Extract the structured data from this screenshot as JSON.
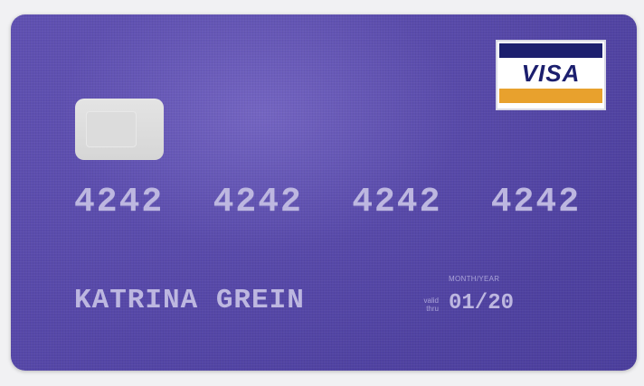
{
  "card": {
    "brand": "VISA",
    "number_groups": [
      "4242",
      "4242",
      "4242",
      "4242"
    ],
    "holder_name": "KATRINA GREIN",
    "expiry_caption": "MONTH/YEAR",
    "valid_thru_line1": "valid",
    "valid_thru_line2": "thru",
    "expiry": "01/20"
  },
  "colors": {
    "card_background": "#5446a6",
    "embossed_text": "#bdb7e0",
    "visa_blue": "#1c1f6e",
    "visa_gold": "#e8a12d",
    "chip": "#dcdcdc"
  },
  "icons": {
    "chip": "emv-chip-icon",
    "brand_logo": "visa-logo-icon"
  }
}
